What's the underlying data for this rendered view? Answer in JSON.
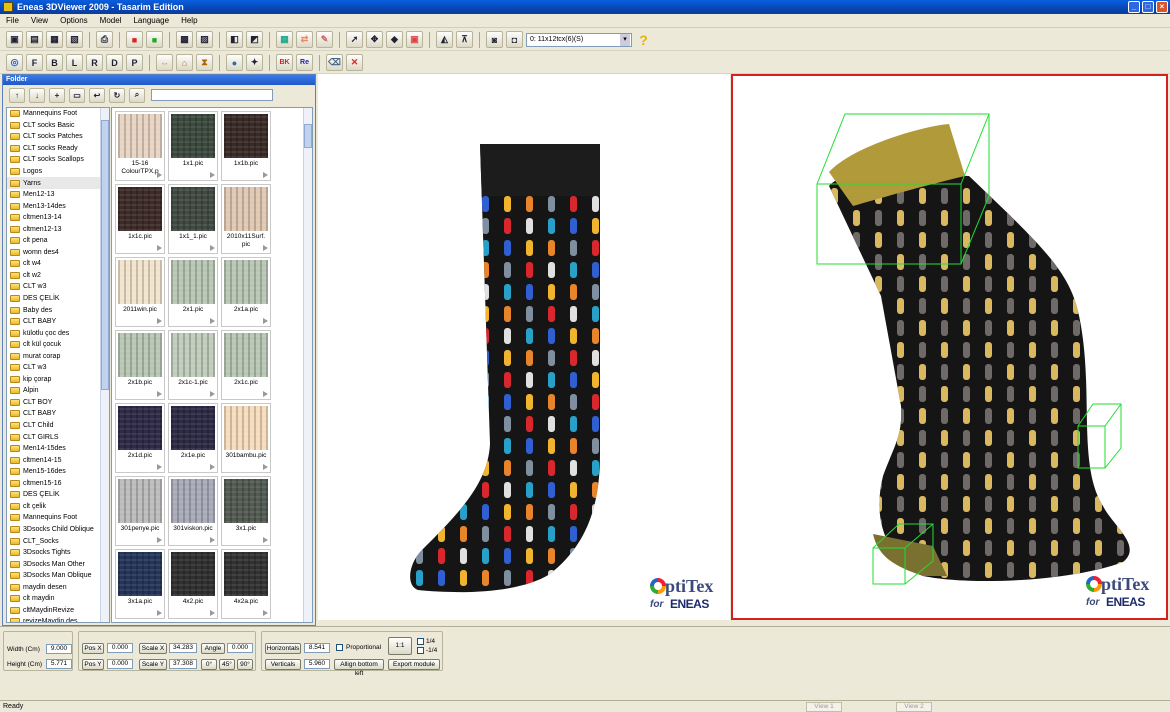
{
  "window": {
    "title": "Eneas 3DViewer 2009 - Tasarim Edition"
  },
  "menu": [
    "File",
    "View",
    "Options",
    "Model",
    "Language",
    "Help"
  ],
  "toolbar": {
    "layout_dropdown": "0: 11x12tcx(6)(S)",
    "help_label": "?"
  },
  "folder_panel": {
    "title": "Folder",
    "tree": [
      "Mannequins Foot",
      "CLT socks Basic",
      "CLT socks Patches",
      "CLT socks Ready",
      "CLT socks Scallops",
      "Logos",
      "Yarns",
      "Men12-13",
      "Men13-14des",
      "cltmen13-14",
      "cltmen12-13",
      "clt pena",
      "womn des4",
      "clt w4",
      "clt w2",
      "CLT w3",
      "DES ÇELİK",
      "Baby des",
      "CLT BABY",
      "külotlu çoc des",
      "clt kül çocuk",
      "murat corap",
      "CLT w3",
      "kip çorap",
      "Alpin",
      "CLT BOY",
      "CLT BABY",
      "CLT Child",
      "CLT GIRLS",
      "Men14-15des",
      "cltmen14-15",
      "Men15-16des",
      "cltmen15-16",
      "DES ÇELİK",
      "clt çelik",
      "Mannequins Foot",
      "3Dsocks Child Oblique",
      "CLT_Socks",
      "3Dsocks Tights",
      "3Dsocks Man Other",
      "3Dsocks Man Oblique",
      "maydin desen",
      "clt maydin",
      "cltMaydinRevize",
      "revizeMaydin.des"
    ],
    "selected_index": 6,
    "thumbnails": [
      {
        "label": "15-16 ColourTPX.p",
        "color": "#e8d4c2"
      },
      {
        "label": "1x1.pic",
        "color": "#3c4a3e"
      },
      {
        "label": "1x1b.pic",
        "color": "#3a2a26"
      },
      {
        "label": "1x1c.pic",
        "color": "#3d2b28"
      },
      {
        "label": "1x1_1.pic",
        "color": "#404a42"
      },
      {
        "label": "2010x11Surf. pic",
        "color": "#e0c8b2"
      },
      {
        "label": "2011win.pic",
        "color": "#f2e4cc"
      },
      {
        "label": "2x1.pic",
        "color": "#b8c6b4"
      },
      {
        "label": "2x1a.pic",
        "color": "#b8c6b4"
      },
      {
        "label": "2x1b.pic",
        "color": "#b8c6b4"
      },
      {
        "label": "2x1c-1.pic",
        "color": "#c0ccbc"
      },
      {
        "label": "2x1c.pic",
        "color": "#b8c6b4"
      },
      {
        "label": "2x1d.pic",
        "color": "#2e2a48"
      },
      {
        "label": "2x1e.pic",
        "color": "#2c2a44"
      },
      {
        "label": "301bambu.pic",
        "color": "#f6dcbc"
      },
      {
        "label": "301penye.pic",
        "color": "#bcbcbc"
      },
      {
        "label": "301viskon.pic",
        "color": "#a8aab8"
      },
      {
        "label": "3x1.pic",
        "color": "#525a52"
      },
      {
        "label": "3x1a.pic",
        "color": "#25355a"
      },
      {
        "label": "4x2.pic",
        "color": "#303030"
      },
      {
        "label": "4x2a.pic",
        "color": "#323232"
      }
    ]
  },
  "shape": {
    "width_label": "Width (Cm)",
    "width_value": "9.000",
    "height_label": "Height (Cm)",
    "height_value": "5.771"
  },
  "transform": {
    "posx_label": "Pos X",
    "posx_value": "0.000",
    "posy_label": "Pos Y",
    "posy_value": "0.000",
    "scalex_label": "Scale X",
    "scalex_value": "34.283",
    "scaley_label": "Scale Y",
    "scaley_value": "37.308",
    "angle_label": "Angle",
    "angle_value": "0.000",
    "angle_buttons": [
      "0°",
      "45°",
      "90°"
    ]
  },
  "module": {
    "horizontals_label": "Horizontals",
    "horizontals_value": "8.541",
    "verticals_label": "Verticals",
    "verticals_value": "5.960",
    "proportional_label": "Proportional",
    "align_label": "Allign bottom left",
    "export_label": "Export module",
    "ratio_label": "1:1",
    "quarter_label": "1/4",
    "neg_quarter_label": "-1/4"
  },
  "logo": {
    "brand": "ptiTex",
    "for_text": "for",
    "eneas": "ENEAS"
  },
  "status": {
    "text": "Ready",
    "view1": "View 1",
    "view2": "View 2"
  },
  "colors": {
    "selection_border": "#d62020",
    "bbox": "#22dd33",
    "cuff": "#b09a3a"
  }
}
